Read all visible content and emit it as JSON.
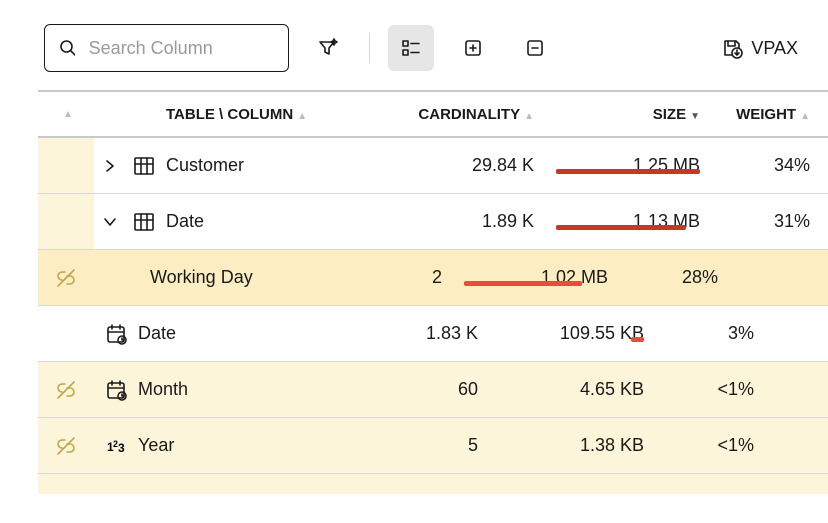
{
  "toolbar": {
    "search_placeholder": "Search Column",
    "vpax_label": "VPAX"
  },
  "headers": {
    "table_column": "TABLE \\ COLUMN",
    "cardinality": "CARDINALITY",
    "size": "SIZE",
    "weight": "WEIGHT"
  },
  "rows": [
    {
      "name": "Customer",
      "card": "29.84 K",
      "size": "1.25 MB",
      "wt": "34%"
    },
    {
      "name": "Date",
      "card": "1.89 K",
      "size": "1.13 MB",
      "wt": "31%"
    },
    {
      "name": "Working Day",
      "card": "2",
      "size": "1.02 MB",
      "wt": "28%"
    },
    {
      "name": "Date",
      "card": "1.83 K",
      "size": "109.55 KB",
      "wt": "3%"
    },
    {
      "name": "Month",
      "card": "60",
      "size": "4.65 KB",
      "wt": "<1%"
    },
    {
      "name": "Year",
      "card": "5",
      "size": "1.38 KB",
      "wt": "<1%"
    }
  ],
  "chart_data": {
    "type": "table",
    "columns": [
      "TABLE \\ COLUMN",
      "CARDINALITY",
      "SIZE",
      "WEIGHT"
    ],
    "sorted_by": "SIZE",
    "sort_dir": "desc",
    "rows": [
      {
        "level": 0,
        "name": "Customer",
        "cardinality": 29840,
        "size_bytes": 1310720,
        "size_label": "1.25 MB",
        "weight_pct": 34
      },
      {
        "level": 0,
        "name": "Date",
        "cardinality": 1890,
        "size_bytes": 1184890,
        "size_label": "1.13 MB",
        "weight_pct": 31
      },
      {
        "level": 1,
        "name": "Working Day",
        "cardinality": 2,
        "size_bytes": 1069547,
        "size_label": "1.02 MB",
        "weight_pct": 28
      },
      {
        "level": 1,
        "name": "Date",
        "cardinality": 1830,
        "size_bytes": 112179,
        "size_label": "109.55 KB",
        "weight_pct": 3
      },
      {
        "level": 1,
        "name": "Month",
        "cardinality": 60,
        "size_bytes": 4762,
        "size_label": "4.65 KB",
        "weight_pct": 0.5
      },
      {
        "level": 1,
        "name": "Year",
        "cardinality": 5,
        "size_bytes": 1413,
        "size_label": "1.38 KB",
        "weight_pct": 0.5
      }
    ]
  }
}
